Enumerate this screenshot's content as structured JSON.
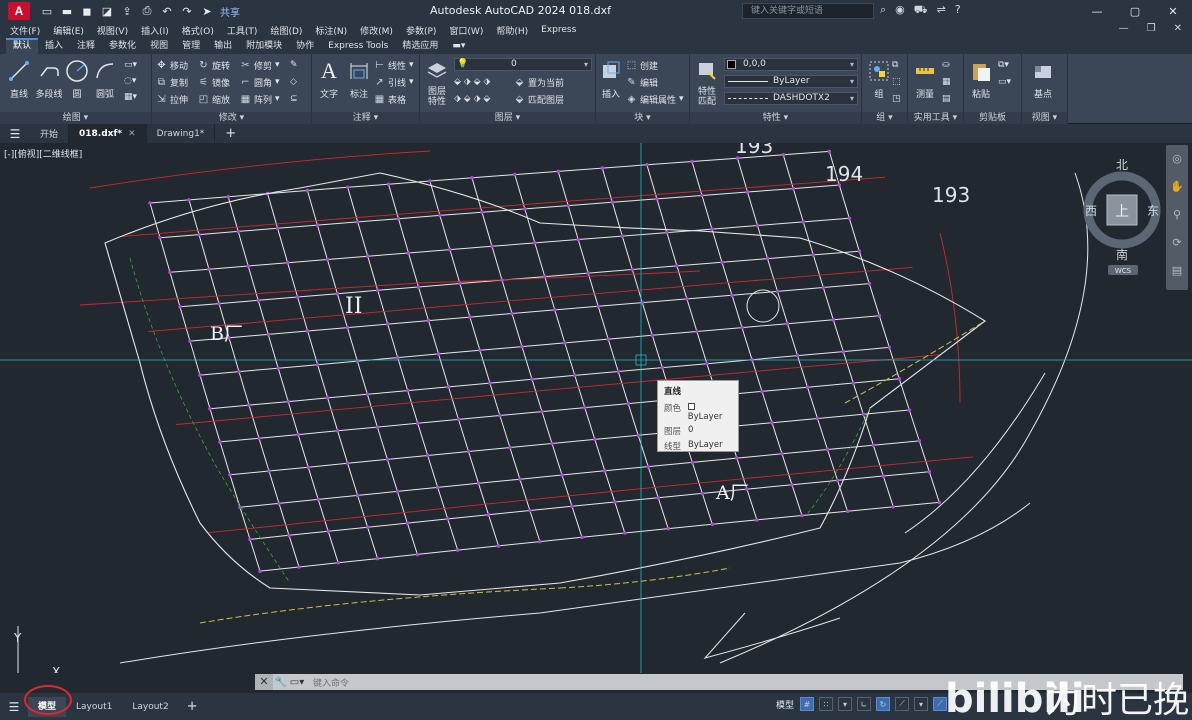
{
  "window": {
    "app_title": "Autodesk AutoCAD 2024    018.dxf",
    "app_logo": "A",
    "share_label": "共享",
    "search_placeholder": "键入关键字或短语",
    "window_controls": [
      "minimize-icon",
      "maximize-icon",
      "close-icon"
    ]
  },
  "menubar": {
    "items": [
      "文件(F)",
      "编辑(E)",
      "视图(V)",
      "插入(I)",
      "格式(O)",
      "工具(T)",
      "绘图(D)",
      "标注(N)",
      "修改(M)",
      "参数(P)",
      "窗口(W)",
      "帮助(H)",
      "Express"
    ]
  },
  "ribbon_tabs": {
    "items": [
      "默认",
      "插入",
      "注释",
      "参数化",
      "视图",
      "管理",
      "输出",
      "附加模块",
      "协作",
      "Express Tools",
      "精选应用"
    ],
    "active": "默认"
  },
  "ribbon": {
    "draw": {
      "title": "绘图",
      "line": "直线",
      "polyline": "多段线",
      "circle": "圆",
      "arc": "圆弧"
    },
    "modify": {
      "title": "修改",
      "move": "移动",
      "rotate": "旋转",
      "trim": "修剪",
      "copy": "复制",
      "mirror": "镜像",
      "fillet": "圆角",
      "stretch": "拉伸",
      "scale": "缩放",
      "array": "阵列"
    },
    "annotation": {
      "title": "注释",
      "text": "文字",
      "dimension": "标注",
      "linear": "线性",
      "leader": "引线",
      "table": "表格"
    },
    "layers": {
      "title": "图层",
      "layer_properties": "图层\n特性",
      "current_layer": "0",
      "set_current": "置为当前",
      "match_layer": "匹配图层"
    },
    "block": {
      "title": "块",
      "insert": "插入",
      "create": "创建",
      "edit": "编辑",
      "edit_attributes": "编辑属性"
    },
    "properties": {
      "title": "特性",
      "match_properties": "特性\n匹配",
      "color": "0,0,0",
      "lineweight": "ByLayer",
      "linetype": "DASHDOTX2"
    },
    "groups": {
      "title": "组",
      "group": "组"
    },
    "utilities": {
      "title": "实用工具",
      "measure": "测量"
    },
    "clipboard": {
      "title": "剪贴板",
      "paste": "粘贴"
    },
    "view": {
      "title": "视图",
      "base": "基点"
    }
  },
  "doc_tabs": {
    "items": [
      "开始",
      "018.dxf*",
      "Drawing1*"
    ],
    "active": "018.dxf*"
  },
  "viewport": {
    "label": "[-][俯视][二维线框]",
    "big_numbers": [
      "193",
      "194",
      "193"
    ],
    "zone_labels": [
      "B厂",
      "II",
      "A厂"
    ]
  },
  "tooltip": {
    "title": "直线",
    "rows": [
      {
        "key": "颜色",
        "value": "ByLayer",
        "swatch": true
      },
      {
        "key": "图层",
        "value": "0",
        "swatch": false
      },
      {
        "key": "线型",
        "value": "ByLayer",
        "swatch": false
      }
    ]
  },
  "viewcube": {
    "north": "北",
    "south": "南",
    "east": "东",
    "west": "西",
    "top": "上",
    "wcs": "WCS"
  },
  "command_line": {
    "placeholder": "键入命令"
  },
  "status_bar": {
    "layout_tabs": [
      "模型",
      "Layout1",
      "Layout2"
    ],
    "active": "模型",
    "model_label": "模型"
  },
  "watermark": {
    "text": "为时已挽",
    "brand": "bilibili"
  },
  "colors": {
    "background": "#212830",
    "street_line": "#e8e8e8",
    "red_line": "#d0282c",
    "magenta_point": "#b04ad8",
    "crosshair": "#2ab8c0",
    "highlight": "#e0282c"
  }
}
